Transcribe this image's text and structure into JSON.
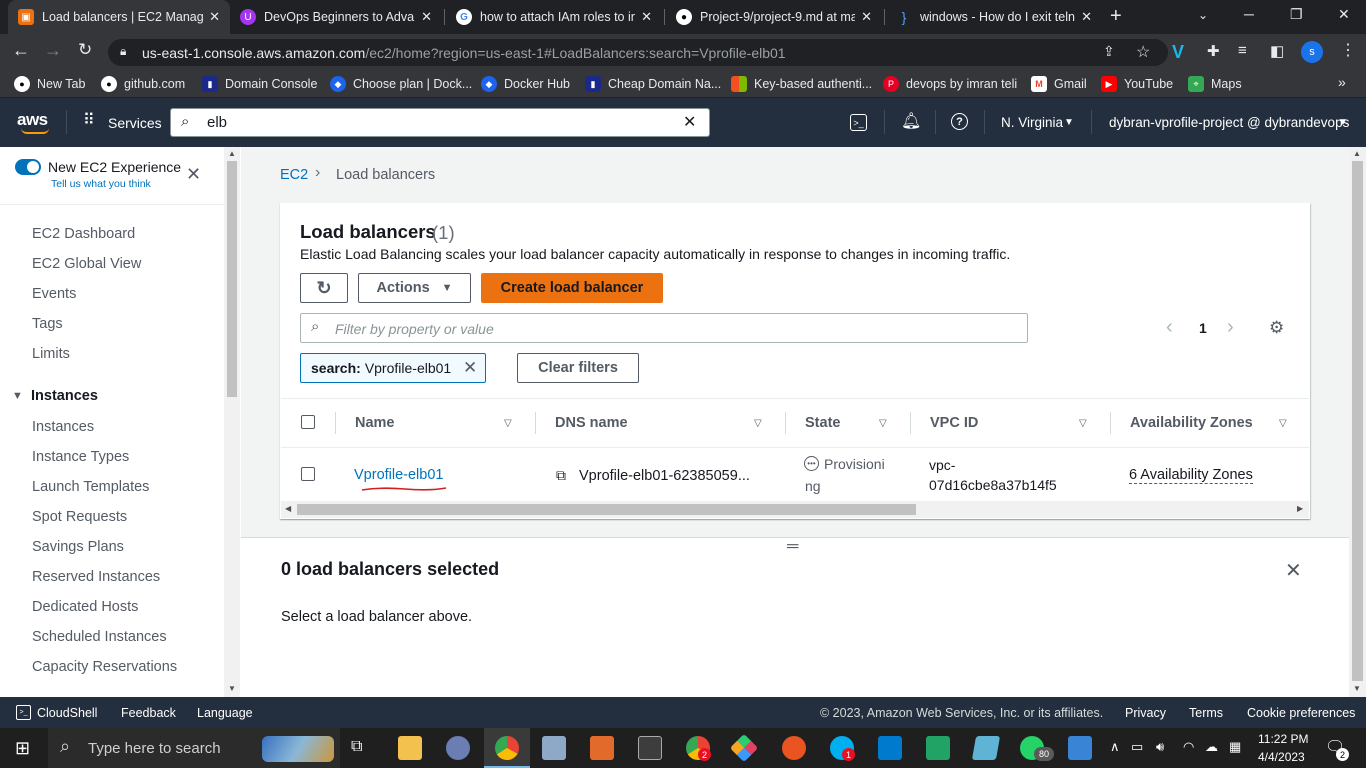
{
  "browser": {
    "tabs": [
      {
        "title": "Load balancers | EC2 Manage",
        "active": true
      },
      {
        "title": "DevOps Beginners to Advanc",
        "active": false
      },
      {
        "title": "how to attach IAm roles to in",
        "active": false
      },
      {
        "title": "Project-9/project-9.md at ma",
        "active": false
      },
      {
        "title": "windows - How do I exit teln",
        "active": false
      }
    ],
    "url_host": "us-east-1.console.aws.amazon.com",
    "url_path": "/ec2/home?region=us-east-1#LoadBalancers:search=Vprofile-elb01",
    "profile_initial": "s",
    "bookmarks": [
      {
        "label": "New Tab",
        "icon": "github-icon"
      },
      {
        "label": "github.com",
        "icon": "github-icon"
      },
      {
        "label": "Domain Console",
        "icon": "domain-icon"
      },
      {
        "label": "Choose plan | Dock...",
        "icon": "docker-icon"
      },
      {
        "label": "Docker Hub",
        "icon": "docker-icon"
      },
      {
        "label": "Cheap Domain Na...",
        "icon": "domain-icon"
      },
      {
        "label": "Key-based authenti...",
        "icon": "microsoft-icon"
      },
      {
        "label": "devops by imran teli",
        "icon": "pinterest-icon"
      },
      {
        "label": "Gmail",
        "icon": "gmail-icon"
      },
      {
        "label": "YouTube",
        "icon": "youtube-icon"
      },
      {
        "label": "Maps",
        "icon": "maps-icon"
      }
    ]
  },
  "aws_nav": {
    "logo": "aws",
    "services_label": "Services",
    "search_value": "elb",
    "region": "N. Virginia",
    "account": "dybran-vprofile-project @ dybrandevops"
  },
  "sidebar": {
    "new_experience_title": "New EC2 Experience",
    "new_experience_sub": "Tell us what you think",
    "items": [
      "EC2 Dashboard",
      "EC2 Global View",
      "Events",
      "Tags",
      "Limits"
    ],
    "section_title": "Instances",
    "section_items": [
      "Instances",
      "Instance Types",
      "Launch Templates",
      "Spot Requests",
      "Savings Plans",
      "Reserved Instances",
      "Dedicated Hosts",
      "Scheduled Instances",
      "Capacity Reservations"
    ]
  },
  "breadcrumb": {
    "root": "EC2",
    "current": "Load balancers"
  },
  "panel": {
    "title": "Load balancers",
    "count": "(1)",
    "description": "Elastic Load Balancing scales your load balancer capacity automatically in response to changes in incoming traffic.",
    "actions_label": "Actions",
    "create_label": "Create load balancer",
    "filter_placeholder": "Filter by property or value",
    "filter_token_key": "search:",
    "filter_token_value": "Vprofile-elb01",
    "clear_filters_label": "Clear filters",
    "page_number": "1",
    "columns": [
      "Name",
      "DNS name",
      "State",
      "VPC ID",
      "Availability Zones"
    ],
    "rows": [
      {
        "name": "Vprofile-elb01",
        "dns": "Vprofile-elb01-62385059...",
        "state_line1": "Provisioni",
        "state_line2": "ng",
        "vpc_line1": "vpc-",
        "vpc_line2": "07d16cbe8a37b14f5",
        "azs": "6 Availability Zones"
      }
    ]
  },
  "split_panel": {
    "title": "0 load balancers selected",
    "message": "Select a load balancer above."
  },
  "footer": {
    "cloudshell": "CloudShell",
    "feedback": "Feedback",
    "language": "Language",
    "copyright": "© 2023, Amazon Web Services, Inc. or its affiliates.",
    "privacy": "Privacy",
    "terms": "Terms",
    "cookies": "Cookie preferences"
  },
  "taskbar": {
    "search_placeholder": "Type here to search",
    "time": "11:22 PM",
    "date": "4/4/2023",
    "notification_count": "2",
    "whatsapp_badge": "80"
  },
  "colors": {
    "aws_nav": "#232f3e",
    "aws_orange": "#ec7211",
    "link_blue": "#0073bb",
    "chrome_dark": "#202124"
  }
}
